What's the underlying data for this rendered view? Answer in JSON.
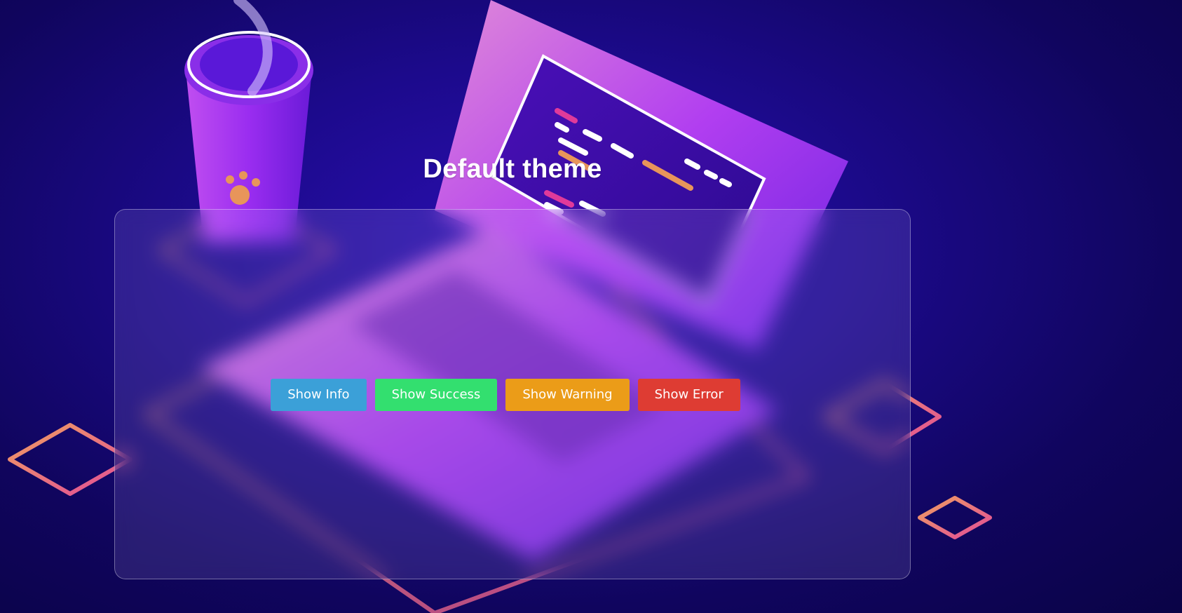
{
  "page": {
    "title": "Default theme"
  },
  "buttons": [
    {
      "id": "info",
      "label": "Show Info",
      "color": "#3ba0d8"
    },
    {
      "id": "success",
      "label": "Show Success",
      "color": "#33df6f"
    },
    {
      "id": "warning",
      "label": "Show Warning",
      "color": "#eb9c18"
    },
    {
      "id": "error",
      "label": "Show Error",
      "color": "#de3c33"
    }
  ],
  "theme": {
    "background": "#1c0a8c",
    "accent_pink": "#e35a8f",
    "accent_orange": "#e8955a",
    "laptop_purple": "#9b2cf2"
  }
}
